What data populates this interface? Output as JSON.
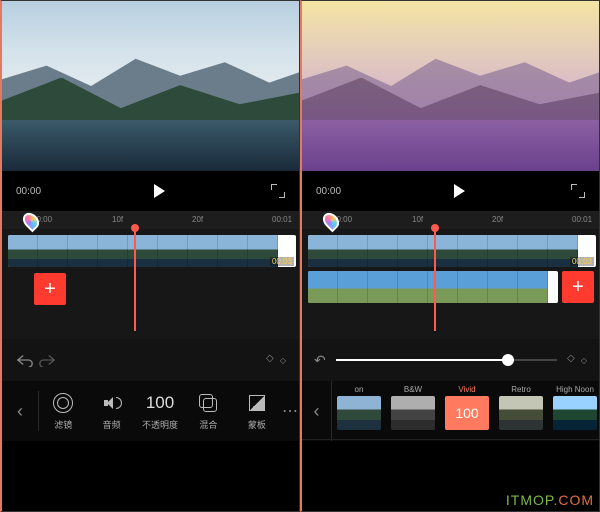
{
  "left": {
    "transport": {
      "time": "00:00"
    },
    "ruler": {
      "t0": "00:00",
      "t1": "10f",
      "t2": "20f",
      "t3": "00:01"
    },
    "clip": {
      "duration": "00:03"
    },
    "toolbar": {
      "opacity_value": "100",
      "items": [
        {
          "label": "滤镜"
        },
        {
          "label": "音频"
        },
        {
          "label": "不透明度"
        },
        {
          "label": "混合"
        },
        {
          "label": "蒙板"
        }
      ]
    }
  },
  "right": {
    "transport": {
      "time": "00:00"
    },
    "ruler": {
      "t0": "00:00",
      "t1": "10f",
      "t2": "20f",
      "t3": "00:01"
    },
    "clip": {
      "duration": "00:03"
    },
    "slider": {
      "value": 78
    },
    "filters": {
      "selected_value": "100",
      "items": [
        {
          "label": "on"
        },
        {
          "label": "B&W"
        },
        {
          "label": "Vivid"
        },
        {
          "label": "Retro"
        },
        {
          "label": "High Noon"
        }
      ]
    }
  },
  "watermark": {
    "text": "ITMOP",
    "suffix": ".COM"
  }
}
